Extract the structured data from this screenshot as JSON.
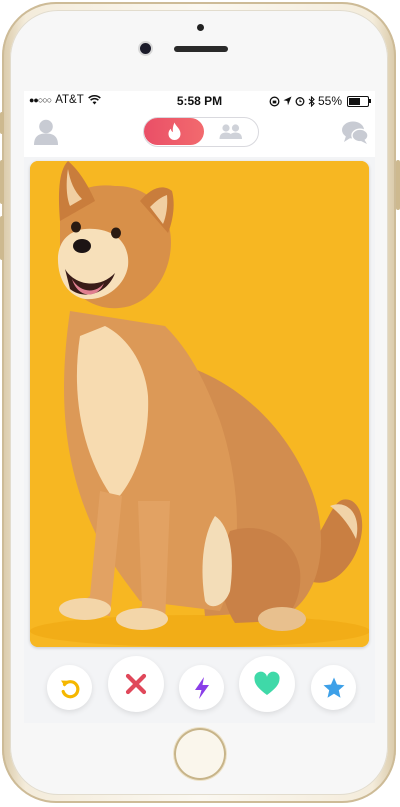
{
  "status_bar": {
    "signal_dots": "●●○○○",
    "carrier": "AT&T",
    "time": "5:58 PM",
    "battery_percent": "55%",
    "battery_level": 0.55
  },
  "nav": {
    "profile_icon": "profile-icon",
    "active_tab_icon": "flame-icon",
    "inactive_tab_icon": "group-icon",
    "messages_icon": "chat-icon"
  },
  "card": {
    "photo_subject": "shiba-inu-photo",
    "background_color": "#F7B722"
  },
  "actions": [
    {
      "icon": "rewind-icon",
      "color": "#F5B700"
    },
    {
      "icon": "nope-icon",
      "color": "#E0485A"
    },
    {
      "icon": "boost-icon",
      "color": "#8A3EE8"
    },
    {
      "icon": "like-icon",
      "color": "#3FD9A8"
    },
    {
      "icon": "super-like-icon",
      "color": "#3DA0E8"
    }
  ]
}
